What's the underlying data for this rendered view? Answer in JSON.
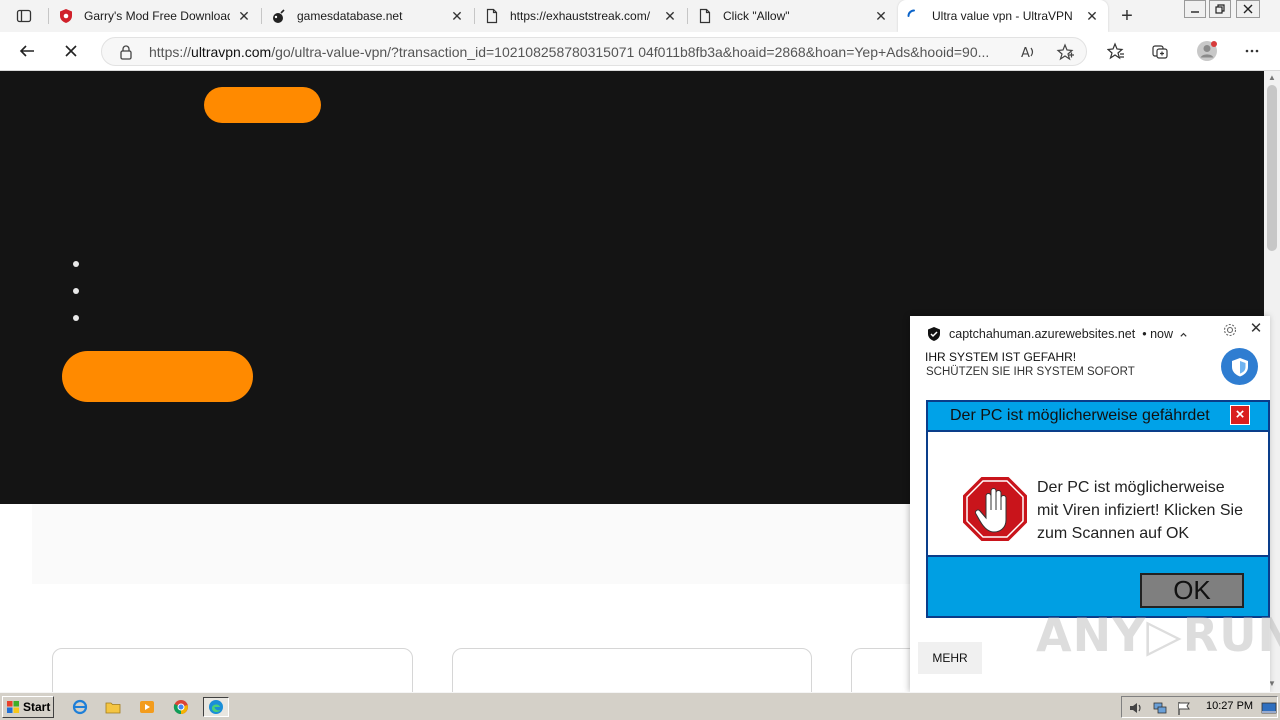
{
  "browser": {
    "tabs": [
      {
        "title": "Garry's Mod Free Download",
        "icon": "red-shield-icon"
      },
      {
        "title": "gamesdatabase.net",
        "icon": "bomb-icon"
      },
      {
        "title": "https://exhauststreak.com/",
        "icon": "page-icon"
      },
      {
        "title": "Click \"Allow\"",
        "icon": "page-icon"
      },
      {
        "title": "Ultra value vpn - UltraVPN",
        "icon": "loading-spinner-icon",
        "active": true
      }
    ],
    "new_tab_symbol": "+",
    "close_symbol": "✕",
    "url_prefix": "https://",
    "url_host": "ultravpn.com",
    "url_path": "/go/ultra-value-vpn/?transaction_id=102108258780315071 04f011b8fb3a&hoaid=2868&hoan=Yep+Ads&hooid=90...",
    "window_controls": [
      "minimize",
      "restore",
      "close"
    ]
  },
  "page": {
    "accent_color": "#ff8a00",
    "hero_color": "#141414"
  },
  "notification": {
    "source": "captchahuman.azurewebsites.net",
    "time": "• now",
    "title": "IHR SYSTEM IST GEFAHR!",
    "body": "SCHÜTZEN SIE IHR SYSTEM SOFORT",
    "image": {
      "header": "Der PC ist möglicherweise gefährdet",
      "message": "Der PC ist möglicherweise mit Viren infiziert! Klicken Sie zum Scannen auf OK",
      "ok_label": "OK"
    },
    "action_label": "MEHR"
  },
  "watermark": "ANY▷RUN",
  "taskbar": {
    "start_label": "Start",
    "clock": "10:27 PM"
  }
}
